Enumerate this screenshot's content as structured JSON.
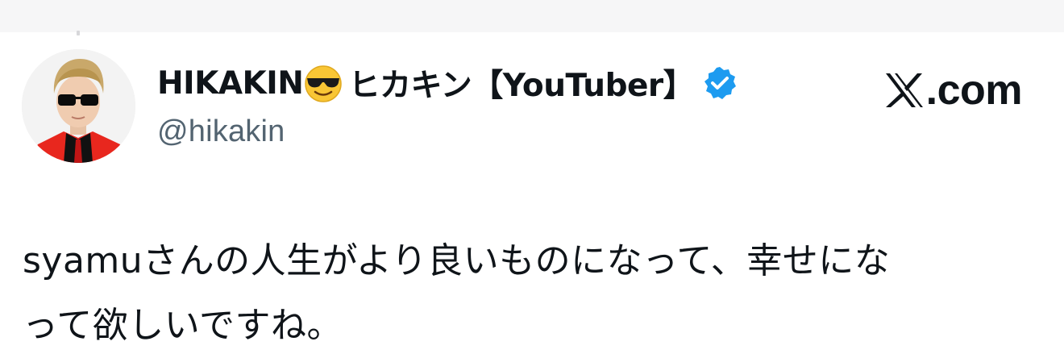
{
  "tweet": {
    "author": {
      "display_name": "HIKAKIN",
      "emoji_icon": "smiling-face-with-sunglasses-icon",
      "display_name_suffix": "ヒカキン【YouTuber】",
      "verified_badge": "verified-badge-icon",
      "handle": "@hikakin"
    },
    "brand": {
      "icon": "x-logo-icon",
      "text": ".com"
    },
    "text": "syamuさんの人生がより良いものになって、幸せにな\nって欲しいですね。"
  },
  "colors": {
    "text_primary": "#0f1419",
    "text_secondary": "#536471",
    "verified_blue": "#1d9bf0"
  }
}
